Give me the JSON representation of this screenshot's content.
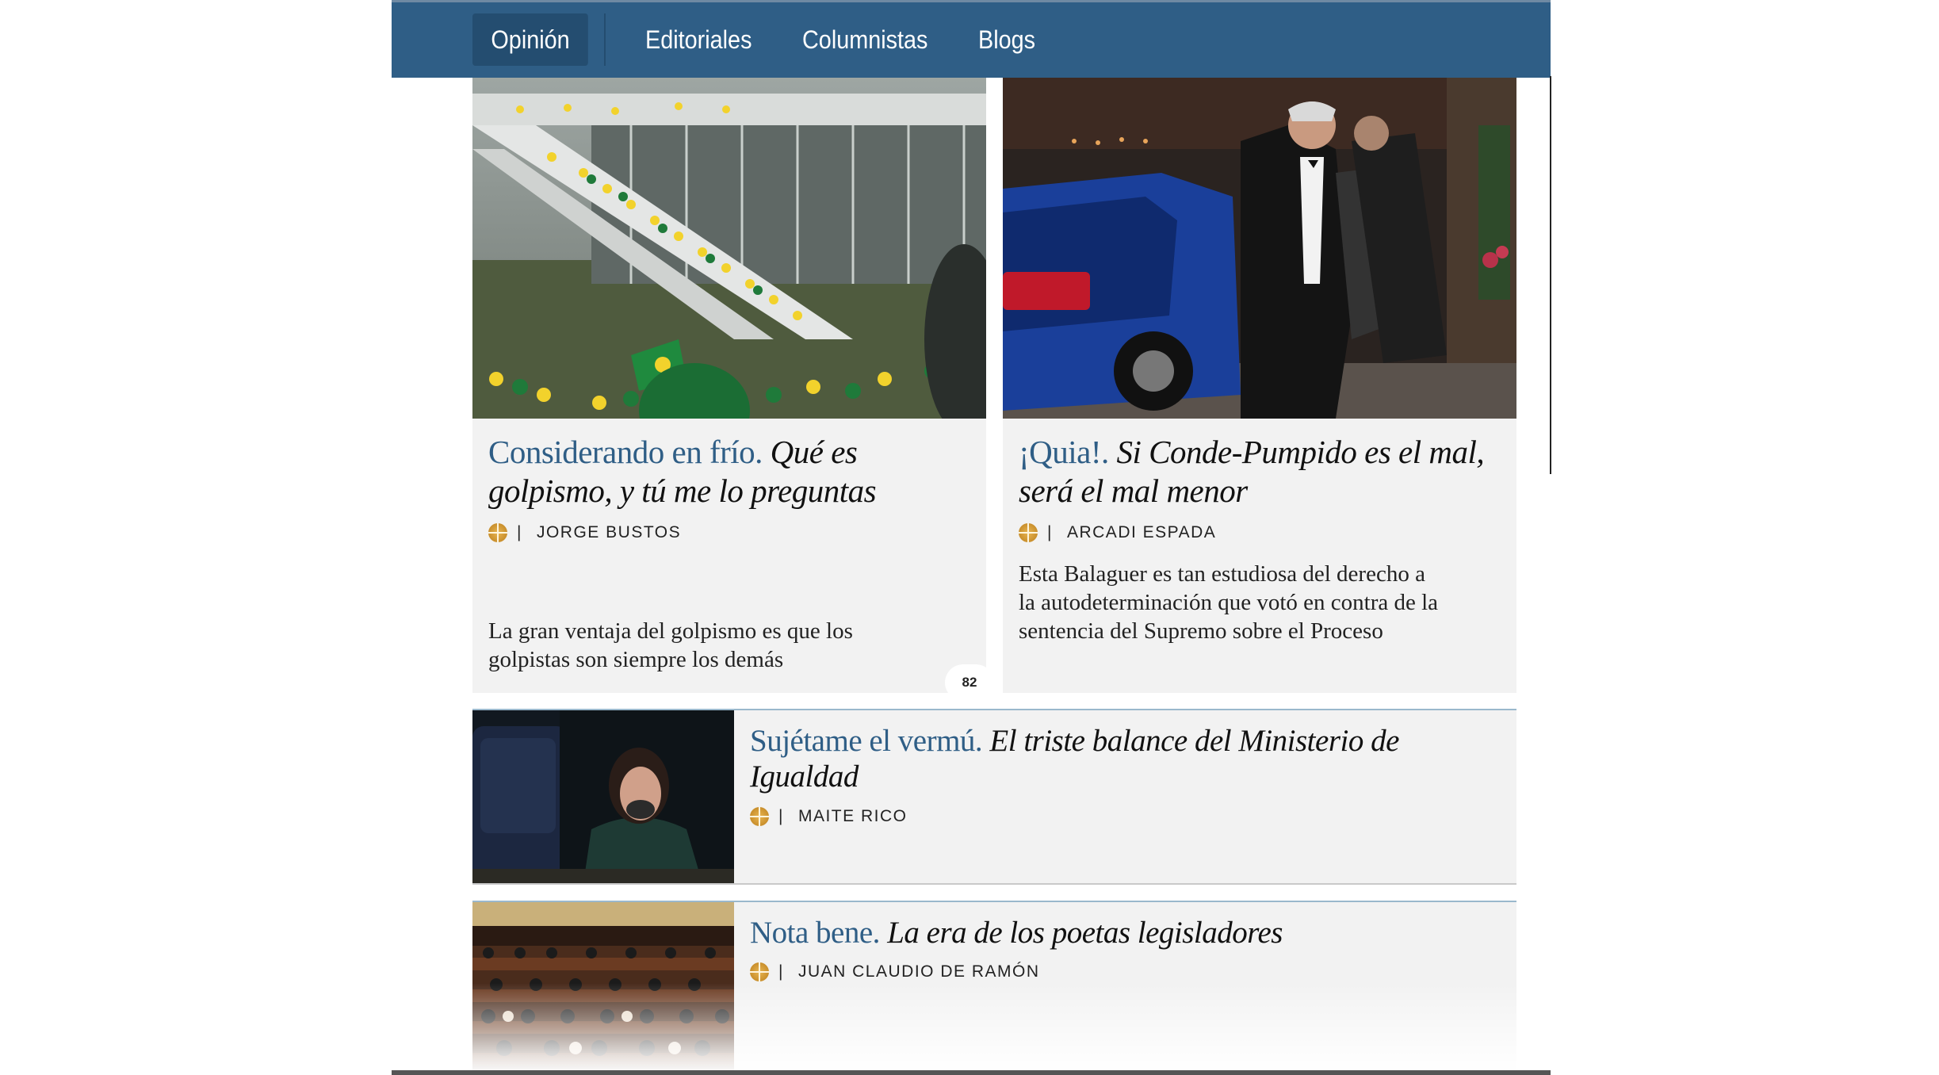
{
  "nav": {
    "tabs": [
      {
        "label": "Opinión",
        "active": true
      },
      {
        "label": "Editoriales"
      },
      {
        "label": "Columnistas"
      },
      {
        "label": "Blogs"
      }
    ]
  },
  "articles": [
    {
      "kicker": "Considerando en frío.",
      "title": "Qué es golpismo, y tú me lo preguntas",
      "author": "JORGE BUSTOS",
      "summary": "La gran ventaja del golpismo es que los golpistas son siempre los demás",
      "comments": "82",
      "photo": "protesters-on-congress-ramp"
    },
    {
      "kicker": "¡Quia!.",
      "title": "Si Conde-Pumpido es el mal, será el mal menor",
      "author": "ARCADI ESPADA",
      "summary": "Esta Balaguer es tan estudiosa del derecho a la autodeterminación que votó en contra de la sentencia del Supremo sobre el Proceso",
      "photo": "man-in-tuxedo-beside-car"
    },
    {
      "kicker": "Sujétame el vermú.",
      "title": "El triste balance del Ministerio de Igualdad",
      "author": "MAITE RICO",
      "photo": "woman-in-parliament-seat"
    },
    {
      "kicker": "Nota bene.",
      "title": "La era de los poetas legisladores",
      "author": "JUAN CLAUDIO DE RAMÓN",
      "photo": "parliament-chamber-rows"
    }
  ],
  "colors": {
    "navbar": "#2f5e86",
    "active_tab": "#244d70",
    "kicker": "#2f5e86",
    "card_bg": "#f2f2f2"
  }
}
